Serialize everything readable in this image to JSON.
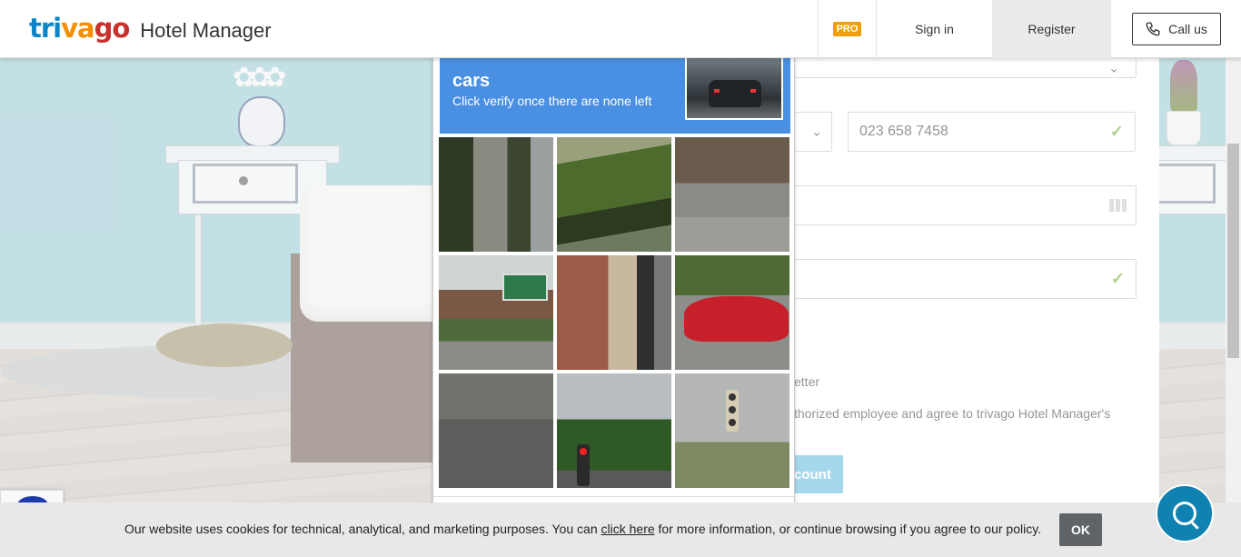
{
  "header": {
    "brand_logo": "trivago",
    "brand_name": "Hotel Manager",
    "pro_badge": "PRO",
    "signin_label": "Sign in",
    "register_label": "Register",
    "call_label": "Call us"
  },
  "form": {
    "phone_value": "023 658 7458",
    "partial_label_1": "etter",
    "partial_label_2": "thorized employee and agree to trivago Hotel Manager's",
    "submit_partial": "count"
  },
  "captcha": {
    "title": "cars",
    "instruction": "Click verify once there are none left"
  },
  "cookie": {
    "text_before": "Our website uses cookies for technical, analytical, and marketing purposes. You can ",
    "link_label": "click here",
    "text_after": " for more information, or continue browsing if you agree to our policy.",
    "ok_label": "OK"
  },
  "colors": {
    "brand_blue": "#0a86c8",
    "brand_orange": "#f48f00",
    "brand_red": "#c9302c",
    "captcha_blue": "#4a90e2",
    "chat_blue": "#0f82b1",
    "pro_orange": "#f0a000",
    "check_green": "#7ab648"
  },
  "icons": {
    "call": "phone-icon",
    "check": "checkmark-icon",
    "chevron": "chevron-down-icon",
    "chat": "chat-bubble-icon",
    "recaptcha": "recaptcha-logo-icon"
  }
}
